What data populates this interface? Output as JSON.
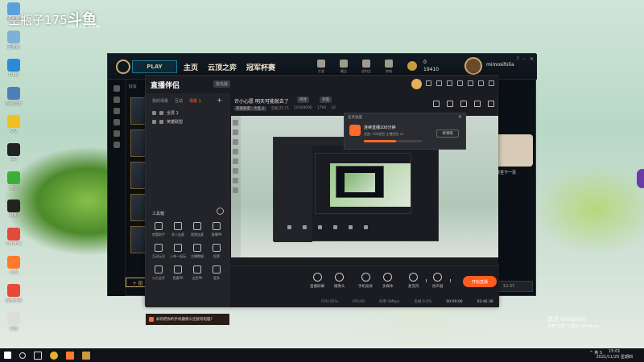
{
  "desktop": {
    "watermark_text": "空瓶子175",
    "watermark_logo": "斗鱼",
    "watermark_sub": "DOUYU.COM",
    "icons": [
      {
        "label": "此电脑",
        "color": "#5aa0e0"
      },
      {
        "label": "回收站",
        "color": "#7fb0d8"
      },
      {
        "label": "Edge",
        "color": "#2a8bd8"
      },
      {
        "label": "控制面板",
        "color": "#4f7fb8"
      },
      {
        "label": "QQ",
        "color": "#f0c020"
      },
      {
        "label": "QQ",
        "color": "#222222"
      },
      {
        "label": "微信",
        "color": "#3cb034"
      },
      {
        "label": "LOL",
        "color": "#222222"
      },
      {
        "label": "Chrome",
        "color": "#e34a3a"
      },
      {
        "label": "斗鱼",
        "color": "#ff7a2a"
      },
      {
        "label": "直播伴侣",
        "color": "#e84a3a"
      },
      {
        "label": "文档",
        "color": "#dddddd"
      }
    ],
    "activate_title": "激活 Windows",
    "activate_sub": "转到\"设置\"以激活 Windows。"
  },
  "lol": {
    "play_label": "PLAY",
    "nav": [
      "主页",
      "云顶之弈",
      "冠军杯赛"
    ],
    "right_icons": [
      {
        "name": "profile-icon",
        "label": "生涯"
      },
      {
        "name": "collection-icon",
        "label": "藏品"
      },
      {
        "name": "tft-icon",
        "label": "战利品"
      },
      {
        "name": "store-icon",
        "label": "商城"
      }
    ],
    "currency_be": "0",
    "currency_rp": "19410",
    "summoner": "mimosifolia",
    "side_label": "好友",
    "right_text": "转至下一页",
    "bottom_btn": "+ 组",
    "bottom_right": "12:37"
  },
  "stream": {
    "app_name": "直播伴侣",
    "beta": "抢先版",
    "tabs": [
      "我的场景",
      "互动",
      "场景 1"
    ],
    "active_tab_index": 2,
    "scenes": [
      {
        "name": "全屏 1"
      },
      {
        "name": "英雄联盟"
      }
    ],
    "tools_title": "工具箱",
    "tools": [
      {
        "name": "tool-assistant",
        "label": "房管助手"
      },
      {
        "name": "tool-multi",
        "label": "多人连麦"
      },
      {
        "name": "tool-effect",
        "label": "视频连麦"
      },
      {
        "name": "tool-pk",
        "label": "直播PK"
      },
      {
        "name": "tool-interact",
        "label": "互动玩法"
      },
      {
        "name": "tool-one",
        "label": "上单一起玩"
      },
      {
        "name": "tool-data",
        "label": "主播数据"
      },
      {
        "name": "tool-vote",
        "label": "投票"
      },
      {
        "name": "tool-fire",
        "label": "火力全开"
      },
      {
        "name": "tool-team",
        "label": "我要PK"
      },
      {
        "name": "tool-all",
        "label": "全民PK"
      },
      {
        "name": "tool-more",
        "label": "更多"
      }
    ],
    "tip": "如何把你的手机摄像头连接到电脑?",
    "title": "许小心愿 明天可能就去了",
    "chip_edit": "修改",
    "chip_cover": "封面",
    "category": "英雄联盟 · 大乱斗",
    "room_name": "空瓶子175",
    "room_id": "10309000",
    "heat": "1794",
    "fans": "42",
    "popup": {
      "title": "任务进度",
      "name": "连续直播100分钟",
      "desc": "奖励: 100经验 主播经验 x1",
      "progress": 0.55,
      "button": "待领取"
    },
    "controls": [
      {
        "name": "screen-share",
        "label": "直播屏幕"
      },
      {
        "name": "camera",
        "label": "摄像头"
      },
      {
        "name": "phone",
        "label": "手机投屏"
      },
      {
        "name": "media",
        "label": "多媒体"
      },
      {
        "name": "mic",
        "label": "麦克风"
      },
      {
        "name": "speaker",
        "label": "扬声器"
      }
    ],
    "go_live": "开始直播",
    "stats": {
      "cpu": "CPU:35%",
      "fps": "FPS:60",
      "bitrate": "码率:5Mbps",
      "frames": "丢帧:0.0%",
      "record": "00:00:00",
      "duration": "02:46:36"
    }
  },
  "taskbar": {
    "time": "15:01",
    "date": "2021/11/25 星期四",
    "tray": "^ 英 S"
  }
}
